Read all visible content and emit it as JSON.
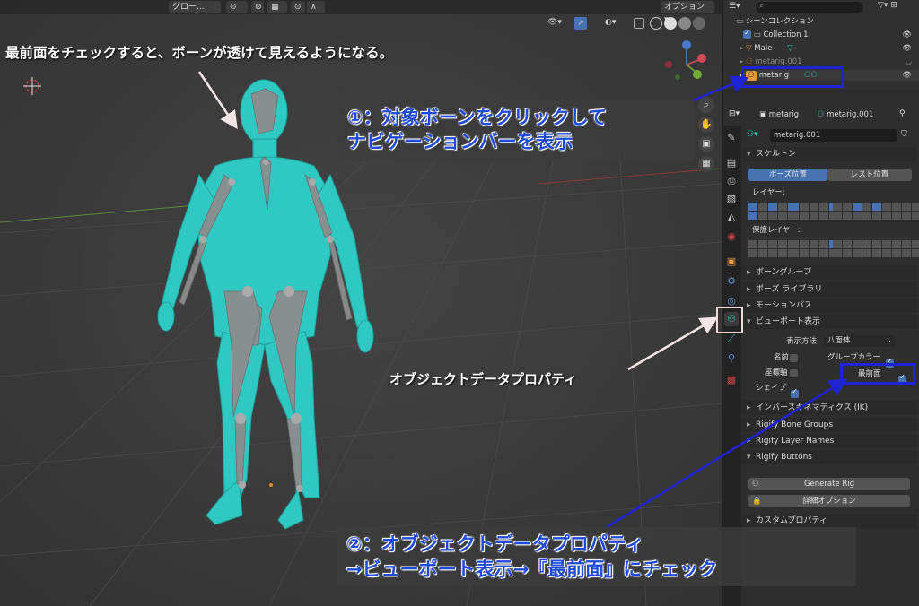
{
  "viewport_header": {
    "mode_label": "グロー...",
    "options_label": "オプション ▾"
  },
  "outliner": {
    "scene_collection": "シーンコレクション",
    "items": [
      {
        "label": "Collection 1"
      },
      {
        "label": "Male"
      },
      {
        "label": "metarig.001"
      },
      {
        "label": "metarig"
      }
    ]
  },
  "properties": {
    "breadcrumb_object": "metarig",
    "breadcrumb_data": "metarig.001",
    "data_name": "metarig.001",
    "skeleton_panel": "スケルトン",
    "pose_position": "ポーズ位置",
    "rest_position": "レスト位置",
    "layers_label": "レイヤー:",
    "protected_layers_label": "保護レイヤー:",
    "bone_groups": "ボーングループ",
    "pose_library": "ポーズ ライブラリ",
    "motion_paths": "モーションパス",
    "viewport_display": "ビューポート表示",
    "display_as_label": "表示方法",
    "display_as_value": "八面体",
    "names_label": "名前",
    "group_colors_label": "グループカラー",
    "axes_label": "座標軸",
    "in_front_label": "最前面",
    "shapes_label": "シェイプ",
    "ik_panel": "インバースキネマティクス (IK)",
    "rigify_bone_groups": "Rigify Bone Groups",
    "rigify_layer_names": "Rigify Layer Names",
    "rigify_buttons": "Rigify Buttons",
    "generate_rig": "Generate Rig",
    "advanced_options": "詳細オプション",
    "custom_properties": "カスタムプロパティ"
  },
  "annotations": {
    "top_note": "最前面をチェックすると、ボーンが透けて見えるようになる。",
    "step1_line1": "①：対象ボーンをクリックして",
    "step1_line2": "ナビゲーションバーを表示",
    "object_data_note": "オブジェクトデータプロパティ",
    "step2_line1": "②：オブジェクトデータプロパティ",
    "step2_line2": "→ビューポート表示→『最前面』にチェック"
  },
  "colors": {
    "accent_blue": "#4772b3",
    "annotation_blue": "#1f23d6",
    "model_cyan": "#2fc8c3"
  }
}
